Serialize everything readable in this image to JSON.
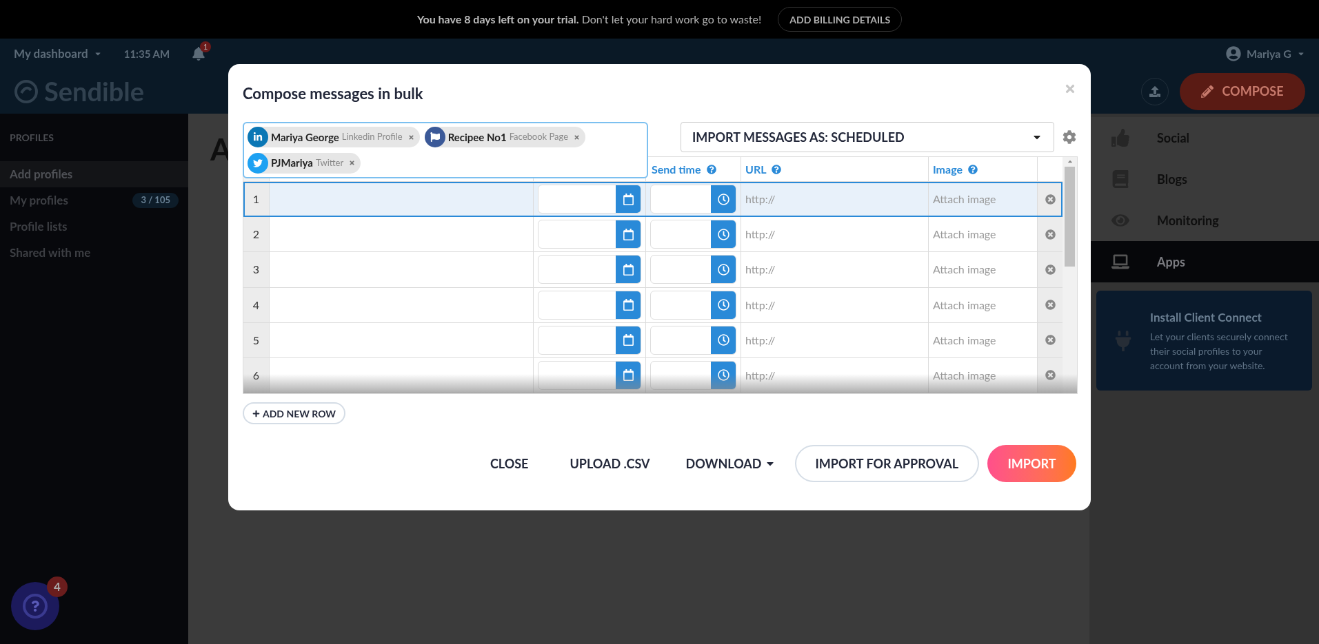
{
  "trial_banner": {
    "bold": "You have 8 days left on your trial.",
    "text": "Don't let your hard work go to waste!",
    "button": "ADD BILLING DETAILS"
  },
  "top_nav": {
    "dashboard_menu": "My dashboard",
    "time": "11:35 AM",
    "notification_count": "1",
    "user_name": "Mariya G",
    "brand": "Sendible",
    "compose": "COMPOSE"
  },
  "sidebar": {
    "title": "PROFILES",
    "items": [
      {
        "label": "Add profiles",
        "selected": true
      },
      {
        "label": "My profiles",
        "badge": "3 / 105",
        "selected": false
      },
      {
        "label": "Profile lists",
        "selected": false
      },
      {
        "label": "Shared with me",
        "selected": false
      }
    ]
  },
  "page_heading": "A",
  "right_nav": {
    "items": [
      {
        "label": "Social",
        "selected": false
      },
      {
        "label": "Blogs",
        "selected": false
      },
      {
        "label": "Monitoring",
        "selected": false
      },
      {
        "label": "Apps",
        "selected": true
      }
    ],
    "card": {
      "title": "Install Client Connect",
      "text": "Let your clients securely connect their social profiles to your account from your website."
    }
  },
  "help_badge": "4",
  "modal": {
    "title": "Compose messages in bulk",
    "profiles": [
      {
        "name": "Mariya George",
        "type": "Linkedin Profile",
        "kind": "linkedin"
      },
      {
        "name": "Recipee No1",
        "type": "Facebook Page",
        "kind": "facebook"
      },
      {
        "name": "PJMariya",
        "type": "Twitter",
        "kind": "twitter"
      }
    ],
    "import_mode": "IMPORT MESSAGES AS: SCHEDULED",
    "column_headers": [
      "Send time",
      "URL",
      "Image"
    ],
    "rows": [
      {
        "number": "1",
        "selected": true,
        "url": "http://",
        "image": "Attach image"
      },
      {
        "number": "2",
        "selected": false,
        "url": "http://",
        "image": "Attach image"
      },
      {
        "number": "3",
        "selected": false,
        "url": "http://",
        "image": "Attach image"
      },
      {
        "number": "4",
        "selected": false,
        "url": "http://",
        "image": "Attach image"
      },
      {
        "number": "5",
        "selected": false,
        "url": "http://",
        "image": "Attach image"
      },
      {
        "number": "6",
        "selected": false,
        "url": "http://",
        "image": "Attach image"
      }
    ],
    "add_row": "ADD NEW ROW",
    "buttons": [
      {
        "label": "CLOSE",
        "kind": "text"
      },
      {
        "label": "UPLOAD .CSV",
        "kind": "text"
      },
      {
        "label": "DOWNLOAD",
        "kind": "dropdown"
      },
      {
        "label": "IMPORT FOR APPROVAL",
        "kind": "outline"
      },
      {
        "label": "IMPORT",
        "kind": "primary"
      }
    ]
  }
}
